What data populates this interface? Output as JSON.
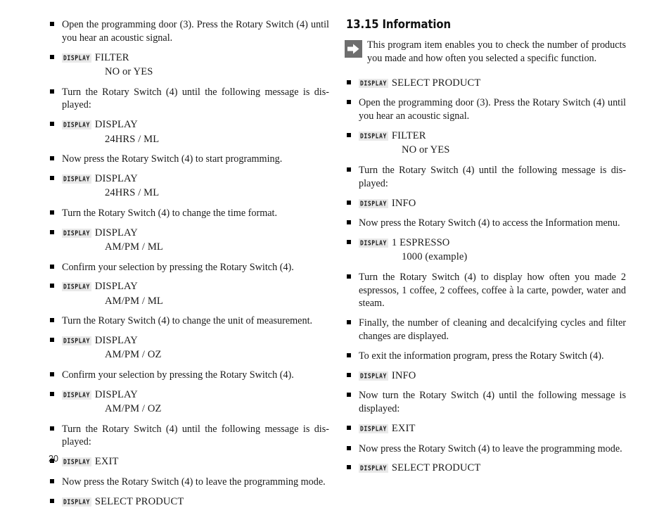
{
  "page": {
    "number": "20",
    "display_badge_label": "DISPLAY"
  },
  "left_column": {
    "items": [
      {
        "type": "text",
        "text": "Open the programming door (3). Press the Rotary Switch (4) until you hear an acoustic signal."
      },
      {
        "type": "display",
        "value": "FILTER",
        "sub": "NO or YES"
      },
      {
        "type": "text",
        "text": "Turn the Rotary Switch (4) until the following message is dis-played:"
      },
      {
        "type": "display",
        "value": "DISPLAY",
        "sub": "24HRS / ML"
      },
      {
        "type": "text",
        "text": "Now press the Rotary Switch (4) to start programming."
      },
      {
        "type": "display",
        "value": "DISPLAY",
        "sub": "24HRS / ML"
      },
      {
        "type": "text",
        "text": "Turn the Rotary Switch (4) to change the time format."
      },
      {
        "type": "display",
        "value": "DISPLAY",
        "sub": "AM/PM / ML"
      },
      {
        "type": "text",
        "text": "Confirm your selection by pressing the Rotary Switch (4)."
      },
      {
        "type": "display",
        "value": "DISPLAY",
        "sub": "AM/PM / ML"
      },
      {
        "type": "text",
        "text": "Turn the Rotary Switch (4) to change the unit of measurement."
      },
      {
        "type": "display",
        "value": "DISPLAY",
        "sub": "AM/PM / OZ"
      },
      {
        "type": "text",
        "text": "Confirm your selection by pressing the Rotary Switch (4)."
      },
      {
        "type": "display",
        "value": "DISPLAY",
        "sub": "AM/PM / OZ"
      },
      {
        "type": "text",
        "text": "Turn the Rotary Switch (4) until the following message is dis-played:"
      },
      {
        "type": "display",
        "value": "EXIT",
        "sub": ""
      },
      {
        "type": "text",
        "text": "Now press the Rotary Switch (4) to leave the programming mode."
      },
      {
        "type": "display",
        "value": "SELECT PRODUCT",
        "sub": ""
      }
    ]
  },
  "right_column": {
    "heading": "13.15 Information",
    "intro": {
      "icon": "arrow-right-icon",
      "text": "This program item enables you to check the number of products you made and how often you selected a specific function."
    },
    "items": [
      {
        "type": "display",
        "value": "SELECT PRODUCT",
        "sub": ""
      },
      {
        "type": "text",
        "text": "Open the programming door (3). Press the Rotary Switch (4) until you hear an acoustic signal."
      },
      {
        "type": "display",
        "value": "FILTER",
        "sub": "NO or YES"
      },
      {
        "type": "text",
        "text": "Turn the Rotary Switch (4) until the following message is dis-played:"
      },
      {
        "type": "display",
        "value": "INFO",
        "sub": ""
      },
      {
        "type": "text",
        "text": "Now press the Rotary Switch (4) to access the Information menu."
      },
      {
        "type": "display",
        "value": "1 ESPRESSO",
        "sub": "1000 (example)"
      },
      {
        "type": "text",
        "text": "Turn the Rotary Switch (4) to display how often you made 2 espressos, 1 coffee, 2 coffees, coffee à la carte, powder, water and steam."
      },
      {
        "type": "text",
        "text": "Finally, the number of cleaning and decalcifying cycles and filter changes are displayed."
      },
      {
        "type": "text",
        "text": "To exit the information program, press the Rotary Switch (4)."
      },
      {
        "type": "display",
        "value": "INFO",
        "sub": ""
      },
      {
        "type": "text",
        "text": "Now turn the Rotary Switch (4) until the following message is displayed:"
      },
      {
        "type": "display",
        "value": "EXIT",
        "sub": ""
      },
      {
        "type": "text",
        "text": "Now press the Rotary Switch (4) to leave the programming mode."
      },
      {
        "type": "display",
        "value": "SELECT PRODUCT",
        "sub": ""
      }
    ]
  }
}
